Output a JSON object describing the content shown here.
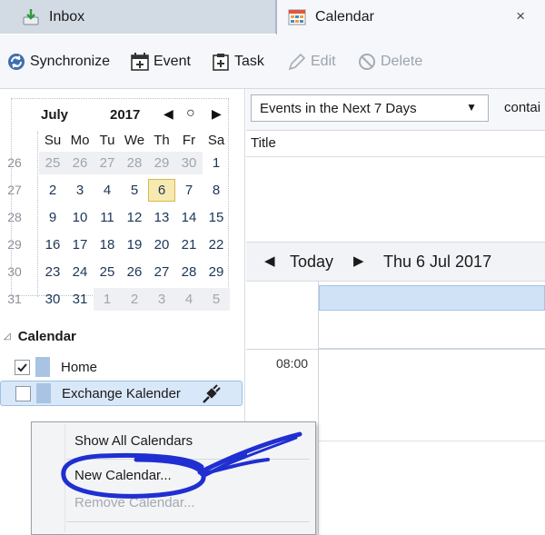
{
  "tabs": [
    {
      "label": "Inbox",
      "icon": "inbox-download-icon"
    },
    {
      "label": "Calendar",
      "icon": "calendar-grid-icon",
      "close_glyph": "×"
    }
  ],
  "toolbar": {
    "synchronize": "Synchronize",
    "event": "Event",
    "task": "Task",
    "edit": "Edit",
    "delete": "Delete"
  },
  "minical": {
    "month": "July",
    "year": "2017",
    "nav_prev": "◀",
    "nav_today": "○",
    "nav_next": "▶",
    "weekdays": [
      "Su",
      "Mo",
      "Tu",
      "We",
      "Th",
      "Fr",
      "Sa"
    ],
    "weeks": [
      {
        "num": "26",
        "days": [
          [
            "25",
            true
          ],
          [
            "26",
            true
          ],
          [
            "27",
            true
          ],
          [
            "28",
            true
          ],
          [
            "29",
            true
          ],
          [
            "30",
            true
          ],
          [
            "1",
            false
          ]
        ]
      },
      {
        "num": "27",
        "days": [
          [
            "2",
            false
          ],
          [
            "3",
            false
          ],
          [
            "4",
            false
          ],
          [
            "5",
            false
          ],
          [
            "6",
            false,
            "today"
          ],
          [
            "7",
            false
          ],
          [
            "8",
            false
          ]
        ]
      },
      {
        "num": "28",
        "days": [
          [
            "9",
            false
          ],
          [
            "10",
            false
          ],
          [
            "11",
            false
          ],
          [
            "12",
            false
          ],
          [
            "13",
            false
          ],
          [
            "14",
            false
          ],
          [
            "15",
            false
          ]
        ]
      },
      {
        "num": "29",
        "days": [
          [
            "16",
            false
          ],
          [
            "17",
            false
          ],
          [
            "18",
            false
          ],
          [
            "19",
            false
          ],
          [
            "20",
            false
          ],
          [
            "21",
            false
          ],
          [
            "22",
            false
          ]
        ]
      },
      {
        "num": "30",
        "days": [
          [
            "23",
            false
          ],
          [
            "24",
            false
          ],
          [
            "25",
            false
          ],
          [
            "26",
            false
          ],
          [
            "27",
            false
          ],
          [
            "28",
            false
          ],
          [
            "29",
            false
          ]
        ]
      },
      {
        "num": "31",
        "days": [
          [
            "30",
            false
          ],
          [
            "31",
            false
          ],
          [
            "1",
            true
          ],
          [
            "2",
            true
          ],
          [
            "3",
            true
          ],
          [
            "4",
            true
          ],
          [
            "5",
            true
          ]
        ]
      }
    ]
  },
  "calendars": {
    "section_title": "Calendar",
    "twisty": "◿",
    "items": [
      {
        "name": "Home",
        "checked": true,
        "color": "#a9c3e3"
      },
      {
        "name": "Exchange Kalender",
        "checked": false,
        "color": "#a9c3e3",
        "icon": "plug-icon"
      }
    ]
  },
  "context_menu": {
    "show_all": "Show All Calendars",
    "new_calendar": "New Calendar...",
    "remove_calendar": "Remove Calendar..."
  },
  "filter": {
    "selected": "Events in the Next 7 Days",
    "contains_label": "contai"
  },
  "list": {
    "column_title": "Title"
  },
  "daynav": {
    "prev": "◀",
    "today": "Today",
    "next": "▶",
    "date": "Thu 6 Jul 2017"
  },
  "dayview": {
    "time_label": "08:00"
  },
  "annotation_color": "#1f2fd1"
}
